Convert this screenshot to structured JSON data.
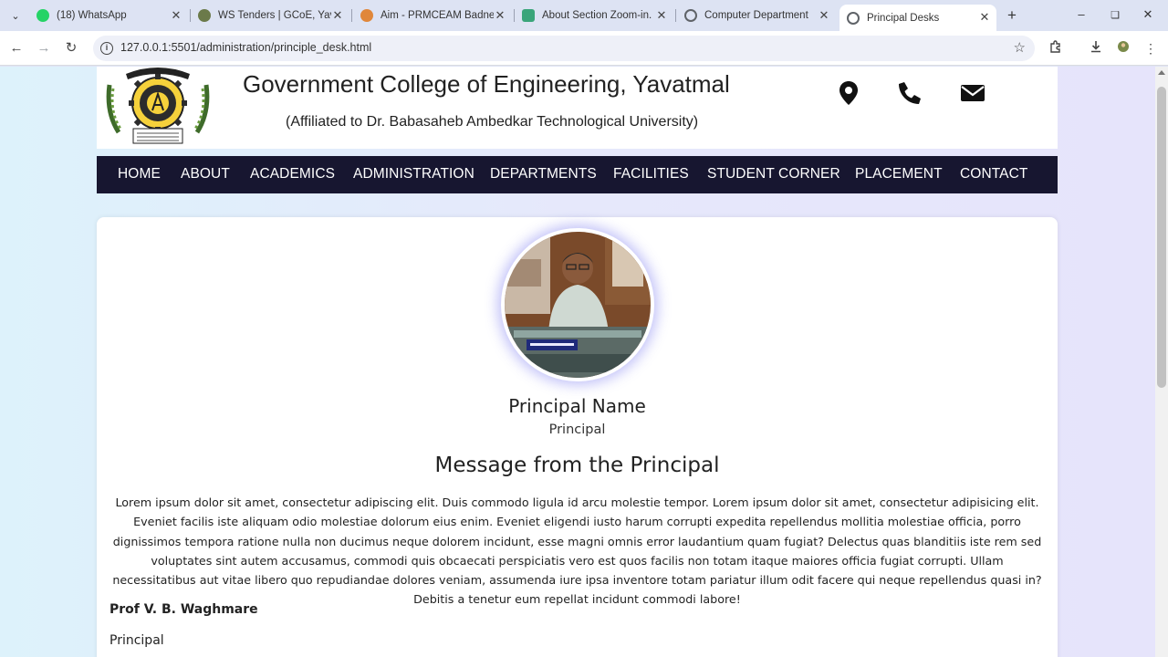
{
  "browser": {
    "tabs": [
      {
        "title": "(18) WhatsApp",
        "favicon_color": "#25d366"
      },
      {
        "title": "WS Tenders | GCoE, Yavatm",
        "favicon_color": "#6b7a4a"
      },
      {
        "title": "Aim - PRMCEAM Badnera",
        "favicon_color": "#e0873a"
      },
      {
        "title": "About Section Zoom-in.",
        "favicon_color": "#3aa57a"
      },
      {
        "title": "Computer Department",
        "favicon_color": "#5f6368"
      },
      {
        "title": "Principal Desks",
        "favicon_color": "#5f6368"
      }
    ],
    "active_tab": "Principal Desks",
    "url": "127.0.0.1:5501/administration/principle_desk.html"
  },
  "header": {
    "college_name": "Government College of Engineering, Yavatmal",
    "affiliation": "(Affiliated to Dr. Babasaheb Ambedkar Technological University)"
  },
  "nav": {
    "items": [
      "HOME",
      "ABOUT",
      "ACADEMICS",
      "ADMINISTRATION",
      "DEPARTMENTS",
      "FACILITIES",
      "STUDENT CORNER",
      "PLACEMENT",
      "CONTACT"
    ]
  },
  "principal": {
    "name": "Principal Name",
    "role": "Principal",
    "message_heading": "Message from the Principal",
    "message": "Lorem ipsum dolor sit amet, consectetur adipiscing elit. Duis commodo ligula id arcu molestie tempor. Lorem ipsum dolor sit amet, consectetur adipisicing elit. Eveniet facilis iste aliquam odio molestiae dolorum eius enim. Eveniet eligendi iusto harum corrupti expedita repellendus mollitia molestiae officia, porro dignissimos tempora ratione nulla non ducimus neque dolorem incidunt, esse magni omnis error laudantium quam fugiat? Delectus quas blanditiis iste rem sed voluptates sint autem accusamus, commodi quis obcaecati perspiciatis vero est quos facilis non totam itaque maiores officia fugiat corrupti. Ullam necessitatibus aut vitae libero quo repudiandae dolores veniam, assumenda iure ipsa inventore totam pariatur illum odit facere qui neque repellendus quasi in? Debitis a tenetur eum repellat incidunt commodi labore!",
    "signature_name": "Prof V. B. Waghmare",
    "signature_role": "Principal"
  },
  "colors": {
    "navbar": "#171630",
    "accent_glow": "#7878f0"
  }
}
